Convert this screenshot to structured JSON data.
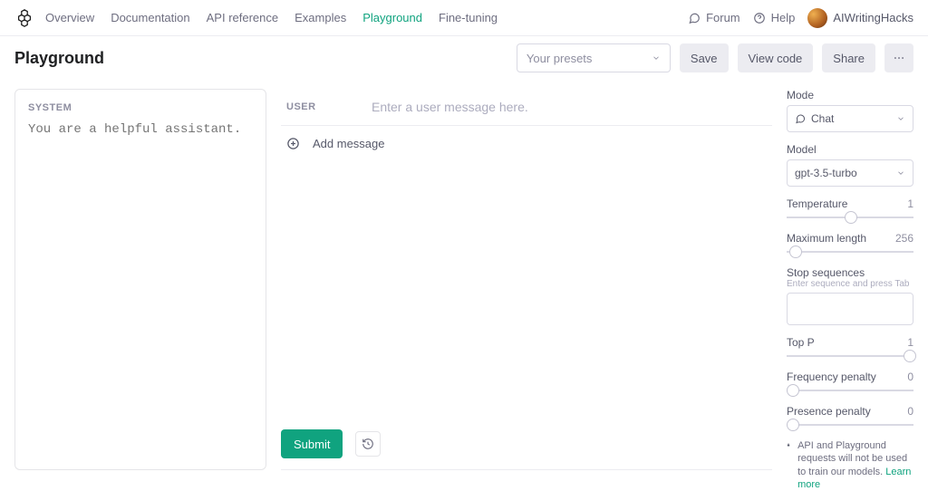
{
  "nav": {
    "items": [
      "Overview",
      "Documentation",
      "API reference",
      "Examples",
      "Playground",
      "Fine-tuning"
    ],
    "active_index": 4,
    "forum": "Forum",
    "help": "Help",
    "username": "AIWritingHacks"
  },
  "header": {
    "title": "Playground",
    "presets_placeholder": "Your presets",
    "save": "Save",
    "view_code": "View code",
    "share": "Share"
  },
  "system": {
    "label": "SYSTEM",
    "placeholder": "You are a helpful assistant."
  },
  "chat": {
    "role": "USER",
    "placeholder": "Enter a user message here.",
    "add_message": "Add message",
    "submit": "Submit"
  },
  "settings": {
    "mode_label": "Mode",
    "mode_value": "Chat",
    "model_label": "Model",
    "model_value": "gpt-3.5-turbo",
    "temperature_label": "Temperature",
    "temperature_value": "1",
    "maxlen_label": "Maximum length",
    "maxlen_value": "256",
    "stop_label": "Stop sequences",
    "stop_hint": "Enter sequence and press Tab",
    "topp_label": "Top P",
    "topp_value": "1",
    "freq_label": "Frequency penalty",
    "freq_value": "0",
    "pres_label": "Presence penalty",
    "pres_value": "0",
    "notice": "API and Playground requests will not be used to train our models.",
    "learn_more": "Learn more"
  },
  "slider_positions": {
    "temperature": 46,
    "maxlen": 2,
    "topp": 92,
    "freq": 0,
    "pres": 0
  }
}
